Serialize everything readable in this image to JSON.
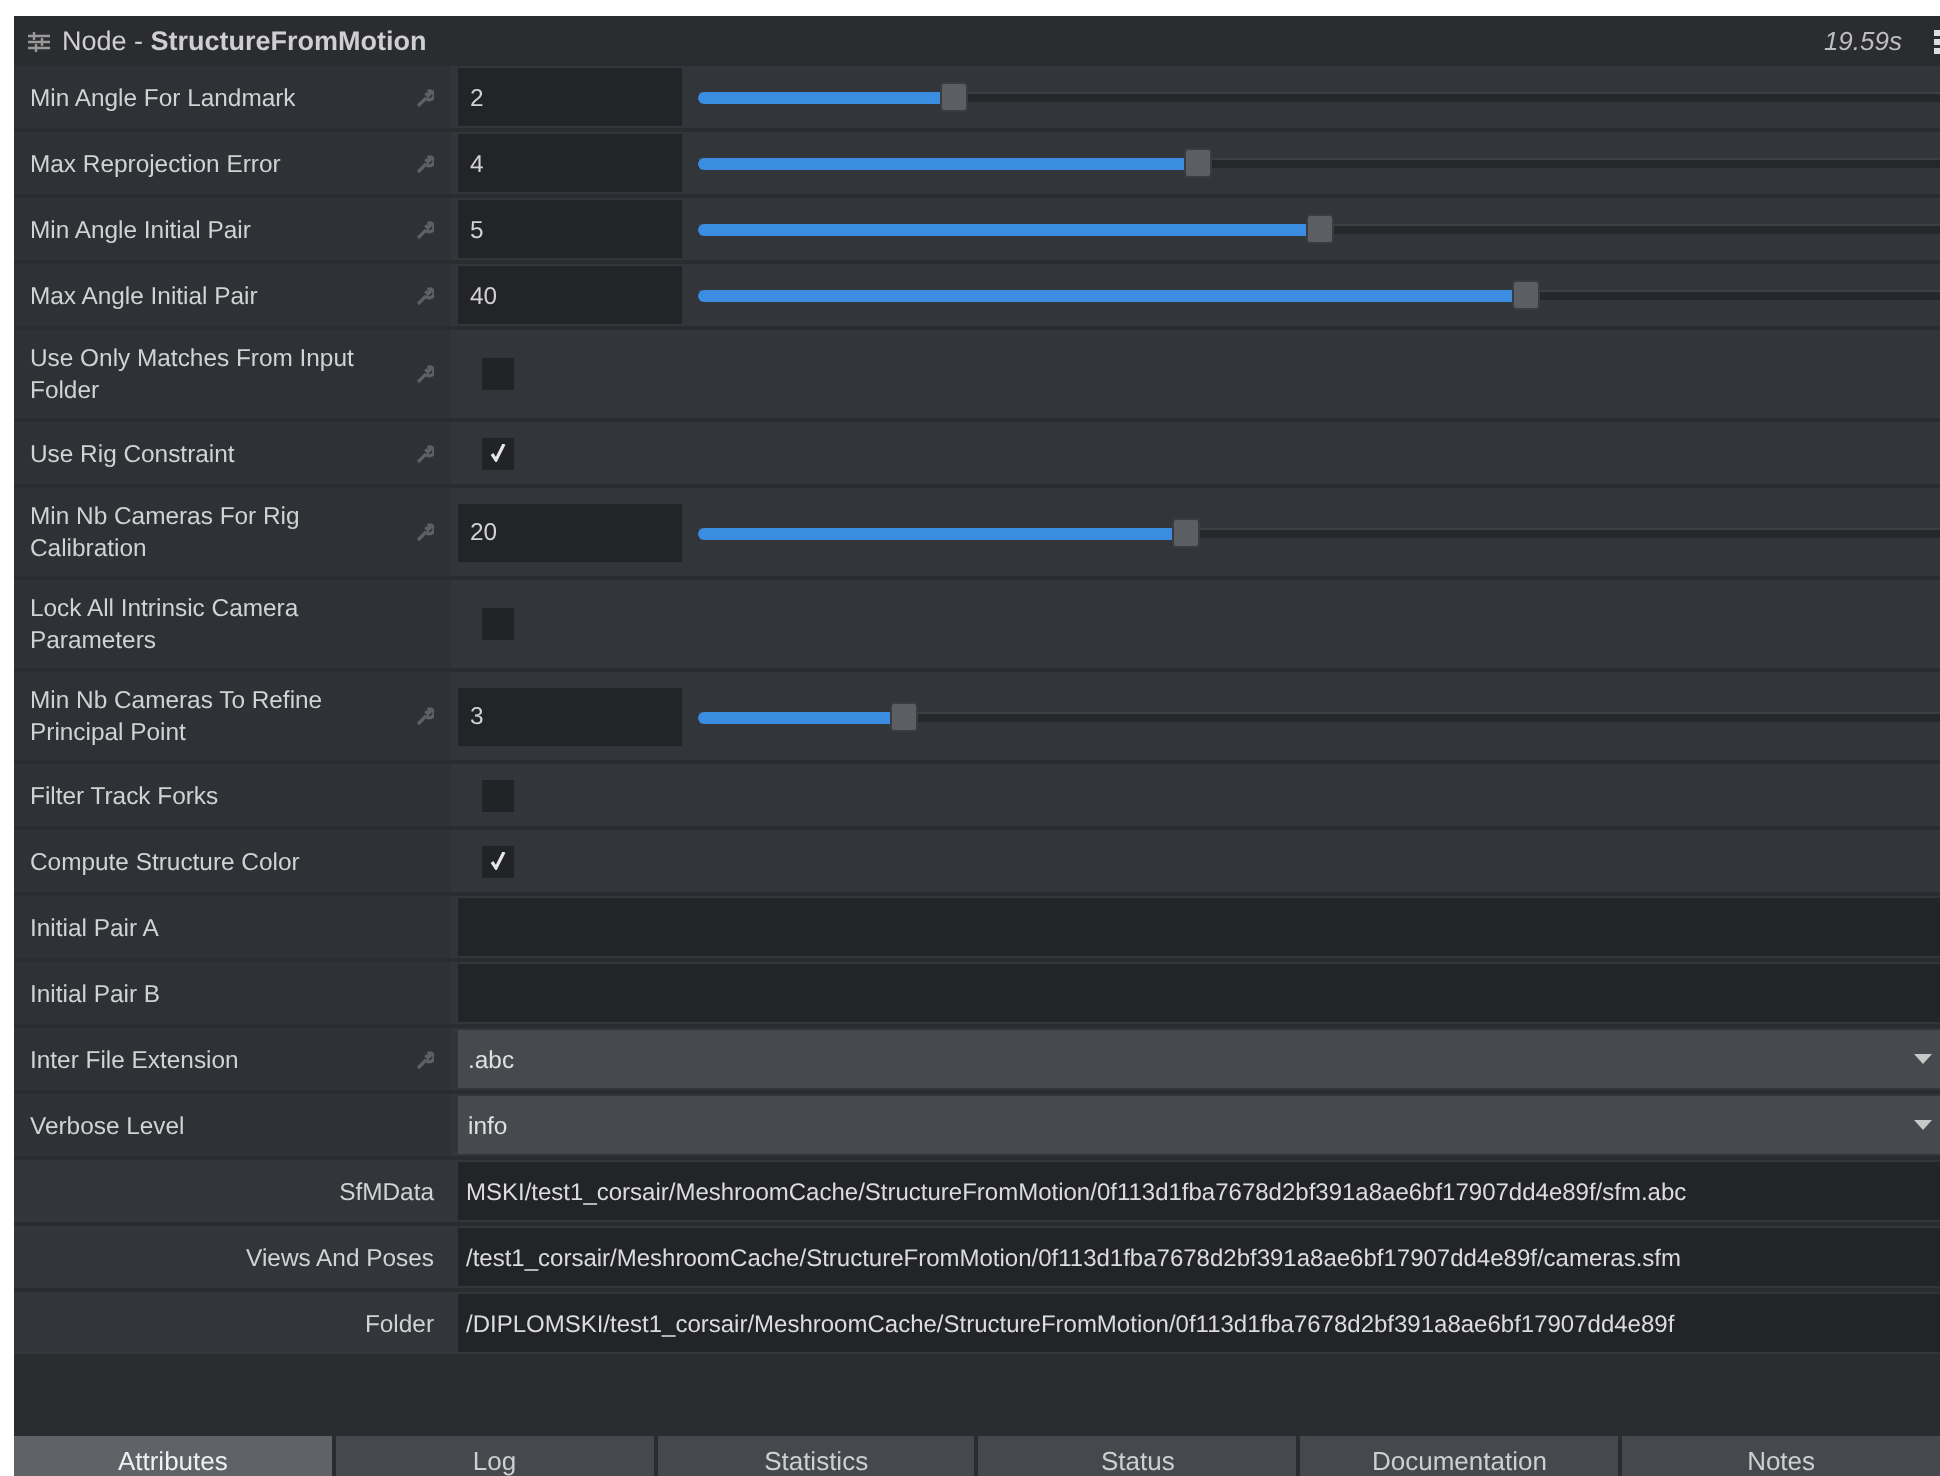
{
  "header": {
    "title": "Node - **StructureFromMotion**",
    "time": "19.59s"
  },
  "rows": [
    {
      "kind": "slider",
      "label": "Min Angle For Landmark",
      "modified": true,
      "value": "2",
      "level": 0.2
    },
    {
      "kind": "slider",
      "label": "Max Reprojection Error",
      "modified": true,
      "value": "4",
      "level": 0.4
    },
    {
      "kind": "slider",
      "label": "Min Angle Initial Pair",
      "modified": true,
      "value": "5",
      "level": 0.5
    },
    {
      "kind": "slider",
      "label": "Max Angle Initial Pair",
      "modified": true,
      "value": "40",
      "level": 0.67
    },
    {
      "kind": "checkbox",
      "label": "Use Only Matches From Input Folder",
      "modified": true,
      "checked": false
    },
    {
      "kind": "checkbox",
      "label": "Use Rig Constraint",
      "modified": true,
      "checked": true
    },
    {
      "kind": "slider",
      "label": "Min Nb Cameras For Rig Calibration",
      "modified": true,
      "value": "20",
      "level": 0.39
    },
    {
      "kind": "checkbox",
      "label": "Lock All Intrinsic Camera Parameters",
      "modified": false,
      "checked": false
    },
    {
      "kind": "slider",
      "label": "Min Nb Cameras To Refine Principal Point",
      "modified": true,
      "value": "3",
      "level": 0.16
    },
    {
      "kind": "checkbox",
      "label": "Filter Track Forks",
      "modified": false,
      "checked": false
    },
    {
      "kind": "checkbox",
      "label": "Compute Structure Color",
      "modified": false,
      "checked": true
    },
    {
      "kind": "text",
      "label": "Initial Pair A",
      "modified": false
    },
    {
      "kind": "text",
      "label": "Initial Pair B",
      "modified": false
    },
    {
      "kind": "combo",
      "label": "Inter File Extension",
      "modified": true,
      "value": ".abc"
    },
    {
      "kind": "combo",
      "label": "Verbose Level",
      "modified": false,
      "value": "info"
    },
    {
      "kind": "path",
      "label": "SfMData",
      "value": "MSKI/test1_corsair/MeshroomCache/StructureFromMotion/0f113d1fba7678d2bf391a8ae6bf17907dd4e89f/sfm.abc"
    },
    {
      "kind": "path",
      "label": "Views And Poses",
      "value": "/test1_corsair/MeshroomCache/StructureFromMotion/0f113d1fba7678d2bf391a8ae6bf17907dd4e89f/cameras.sfm"
    },
    {
      "kind": "path",
      "label": "Folder",
      "value": "/DIPLOMSKI/test1_corsair/MeshroomCache/StructureFromMotion/0f113d1fba7678d2bf391a8ae6bf17907dd4e89f"
    }
  ],
  "tabs": [
    {
      "label": "Attributes",
      "selected": true
    },
    {
      "label": "Log",
      "selected": false
    },
    {
      "label": "Statistics",
      "selected": false
    },
    {
      "label": "Status",
      "selected": false
    },
    {
      "label": "Documentation",
      "selected": false
    },
    {
      "label": "Notes",
      "selected": false
    }
  ]
}
